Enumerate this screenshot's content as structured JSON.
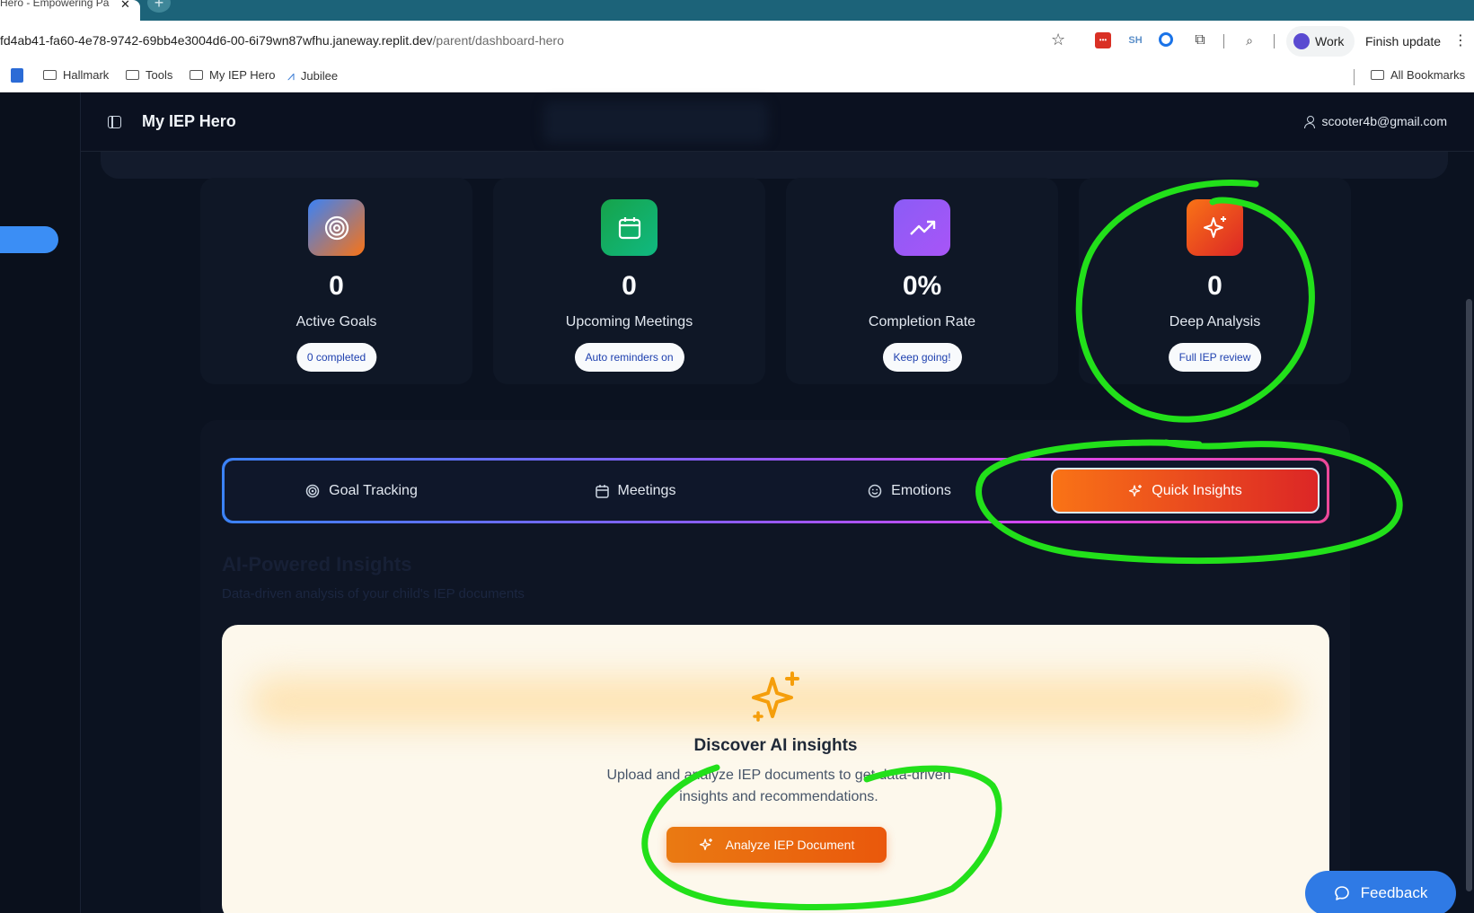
{
  "browser": {
    "tab_title": "Hero - Empowering Pa",
    "tab_close": "✕",
    "new_tab": "+",
    "url_host": "fd4ab41-fa60-4e78-9742-69bb4e3004d6-00-6i79wn87wfhu.janeway.replit.dev",
    "url_path": "/parent/dashboard-hero",
    "profile_label": "Work",
    "finish_update_label": "Finish update",
    "ext_sh": "SH",
    "bookmarks": [
      {
        "label": "Hallmark"
      },
      {
        "label": "Tools"
      },
      {
        "label": "My IEP Hero"
      },
      {
        "label": "Jubilee"
      }
    ],
    "all_bookmarks": "All Bookmarks"
  },
  "header": {
    "title": "My IEP Hero",
    "user_email": "scooter4b@gmail.com"
  },
  "stats": [
    {
      "value": "0",
      "label": "Active Goals",
      "badge": "0 completed",
      "icon": "target-icon"
    },
    {
      "value": "0",
      "label": "Upcoming Meetings",
      "badge": "Auto reminders on",
      "icon": "calendar-icon"
    },
    {
      "value": "0%",
      "label": "Completion Rate",
      "badge": "Keep going!",
      "icon": "trending-up-icon"
    },
    {
      "value": "0",
      "label": "Deep Analysis",
      "badge": "Full IEP review",
      "icon": "sparkles-icon"
    }
  ],
  "tabs": [
    {
      "label": "Goal Tracking",
      "icon": "target-icon"
    },
    {
      "label": "Meetings",
      "icon": "calendar-icon"
    },
    {
      "label": "Emotions",
      "icon": "smile-icon"
    },
    {
      "label": "Quick Insights",
      "icon": "sparkles-icon",
      "active": true
    }
  ],
  "insights": {
    "title": "AI-Powered Insights",
    "subtitle": "Data-driven analysis of your child's IEP documents",
    "card_title": "Discover AI insights",
    "card_text": "Upload and analyze IEP documents to get data-driven insights and recommendations.",
    "button_label": "Analyze IEP Document"
  },
  "feedback_label": "Feedback",
  "colors": {
    "accent_blue": "#3b8ef5",
    "accent_orange": "#f97316",
    "annotation_green": "#22e01a"
  }
}
